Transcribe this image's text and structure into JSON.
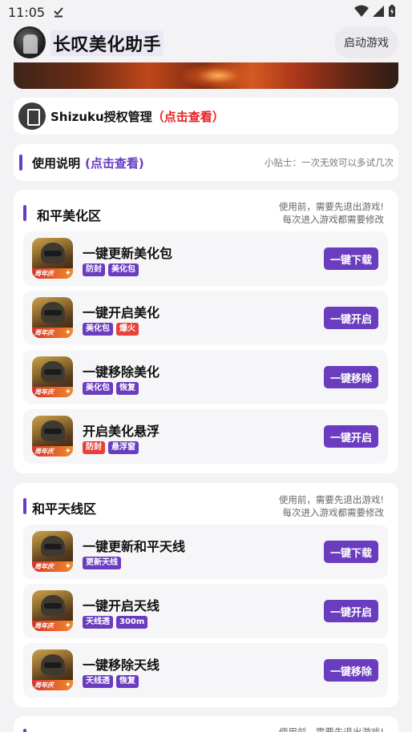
{
  "status": {
    "time": "11:05"
  },
  "header": {
    "title": "长叹美化助手",
    "launch_label": "启动游戏"
  },
  "shizuku": {
    "label": "Shizuku授权管理",
    "link": "（点击查看）"
  },
  "usage": {
    "label": "使用说明",
    "link": "(点击查看)",
    "tip": "小贴士：一次无效可以多试几次"
  },
  "colors": {
    "accent": "#6a3cc0",
    "red": "#e82020",
    "tag_red": "#e8403a"
  },
  "sections": [
    {
      "title": "和平美化区",
      "note_line1": "使用前，需要先退出游戏!",
      "note_line2": "每次进入游戏都需要修改",
      "items": [
        {
          "title": "一键更新美化包",
          "tags": [
            {
              "text": "防封",
              "color": "purple"
            },
            {
              "text": "美化包",
              "color": "purple"
            }
          ],
          "button": "一键下载",
          "badge": "周年庆"
        },
        {
          "title": "一键开启美化",
          "tags": [
            {
              "text": "美化包",
              "color": "purple"
            },
            {
              "text": "爆火",
              "color": "red"
            }
          ],
          "button": "一键开启",
          "badge": "周年庆"
        },
        {
          "title": "一键移除美化",
          "tags": [
            {
              "text": "美化包",
              "color": "purple"
            },
            {
              "text": "恢复",
              "color": "purple"
            }
          ],
          "button": "一键移除",
          "badge": "周年庆"
        },
        {
          "title": "开启美化悬浮",
          "tags": [
            {
              "text": "防封",
              "color": "red"
            },
            {
              "text": "悬浮窗",
              "color": "purple"
            }
          ],
          "button": "一键开启",
          "badge": "周年庆"
        }
      ]
    },
    {
      "title": "和平天线区",
      "note_line1": "使用前，需要先退出游戏!",
      "note_line2": "每次进入游戏都需要修改",
      "items": [
        {
          "title": "一键更新和平天线",
          "tags": [
            {
              "text": "更新天线",
              "color": "purple"
            }
          ],
          "button": "一键下载",
          "badge": "周年庆"
        },
        {
          "title": "一键开启天线",
          "tags": [
            {
              "text": "天线透",
              "color": "purple"
            },
            {
              "text": "300m",
              "color": "purple"
            }
          ],
          "button": "一键开启",
          "badge": "周年庆"
        },
        {
          "title": "一键移除天线",
          "tags": [
            {
              "text": "天线透",
              "color": "purple"
            },
            {
              "text": "恢复",
              "color": "purple"
            }
          ],
          "button": "一键移除",
          "badge": "周年庆"
        }
      ]
    }
  ],
  "bottom_note": "使用前，需要先退出游戏!"
}
